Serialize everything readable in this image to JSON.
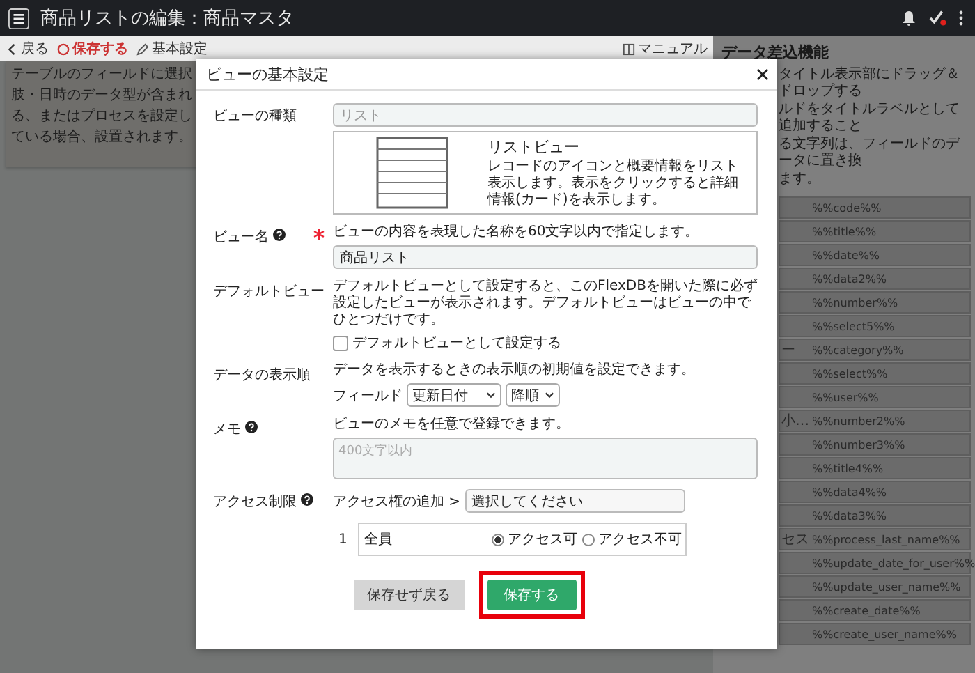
{
  "header": {
    "title": "商品リストの編集：商品マスタ"
  },
  "toolbar": {
    "back": "戻る",
    "save": "保存する",
    "settings": "基本設定",
    "manual": "マニュアル"
  },
  "left_panel": {
    "text": "テーブルのフィールドに選択肢・日時のデータ型が含まれる、またはプロセスを設定している場合、設置されます。"
  },
  "right_panel": {
    "title": "データ差込機能",
    "lines": [
      "タイトル表示部にドラッグ＆ドロップする",
      "ルドをタイトルラベルとして追加すること",
      "る文字列は、フィールドのデータに置き換",
      "ます。"
    ],
    "placeholders": [
      {
        "value": "%%code%%"
      },
      {
        "value": "%%title%%"
      },
      {
        "value": "%%date%%"
      },
      {
        "value": "%%data2%%"
      },
      {
        "value": "%%number%%"
      },
      {
        "value": "%%select5%%"
      },
      {
        "label": "ー",
        "value": "%%category%%"
      },
      {
        "value": "%%select%%"
      },
      {
        "value": "%%user%%"
      },
      {
        "label": "小…",
        "value": "%%number2%%"
      },
      {
        "value": "%%number3%%"
      },
      {
        "value": "%%title4%%"
      },
      {
        "value": "%%data4%%"
      },
      {
        "value": "%%data3%%"
      },
      {
        "label": "セス",
        "value": "%%process_last_name%%"
      },
      {
        "value": "%%update_date_for_user%%"
      },
      {
        "value": "%%update_user_name%%"
      },
      {
        "value": "%%create_date%%"
      },
      {
        "value": "%%create_user_name%%"
      }
    ]
  },
  "dialog": {
    "title": "ビューの基本設定",
    "view_type": {
      "label": "ビューの種類",
      "value": "リスト",
      "preview_title": "リストビュー",
      "preview_text": "レコードのアイコンと概要情報をリスト表示します。表示をクリックすると詳細情報(カード)を表示します。"
    },
    "view_name": {
      "label": "ビュー名",
      "required": true,
      "hint": "ビューの内容を表現した名称を60文字以内で指定します。",
      "value": "商品リスト"
    },
    "default_view": {
      "label": "デフォルトビュー",
      "text": "デフォルトビューとして設定すると、このFlexDBを開いた際に必ず設定したビューが表示されます。デフォルトビューはビューの中でひとつだけです。",
      "checkbox": "デフォルトビューとして設定する",
      "checked": false
    },
    "sort": {
      "label": "データの表示順",
      "hint": "データを表示するときの表示順の初期値を設定できます。",
      "field_label": "フィールド",
      "field": "更新日付",
      "order": "降順"
    },
    "memo": {
      "label": "メモ",
      "hint": "ビューのメモを任意で登録できます。",
      "placeholder": "400文字以内"
    },
    "access": {
      "label": "アクセス制限",
      "add_label": "アクセス権の追加 >",
      "select_placeholder": "選択してください",
      "rows": [
        {
          "number": "1",
          "name": "全員",
          "options": [
            {
              "label": "アクセス可",
              "selected": true
            },
            {
              "label": "アクセス不可",
              "selected": false
            }
          ]
        }
      ]
    },
    "buttons": [
      {
        "label": "保存せず戻る",
        "kind": "secondary",
        "highlighted": false
      },
      {
        "label": "保存する",
        "kind": "primary",
        "highlighted": true
      }
    ]
  }
}
